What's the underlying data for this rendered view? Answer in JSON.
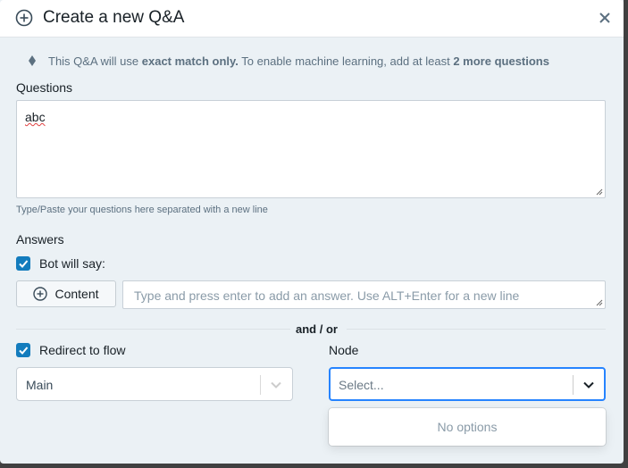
{
  "dialog": {
    "title": "Create a new Q&A"
  },
  "info": {
    "text_before": "This Q&A will use ",
    "bold1": "exact match only.",
    "text_middle": " To enable machine learning, add at least ",
    "bold2": "2 more questions"
  },
  "questions": {
    "label": "Questions",
    "value": "abc",
    "hint": "Type/Paste your questions here separated with a new line"
  },
  "answers": {
    "label": "Answers",
    "bot_will_say_label": "Bot will say:",
    "bot_will_say_checked": true,
    "content_button_label": "Content",
    "answer_placeholder": "Type and press enter to add an answer. Use ALT+Enter for a new line"
  },
  "andor": "and / or",
  "redirect": {
    "label": "Redirect to flow",
    "checked": true,
    "flow_value": "Main"
  },
  "node": {
    "label": "Node",
    "placeholder": "Select...",
    "no_options": "No options"
  },
  "colors": {
    "accent": "#137cbd",
    "focus_border": "#2684ff",
    "dialog_bg": "#ebf1f5"
  }
}
